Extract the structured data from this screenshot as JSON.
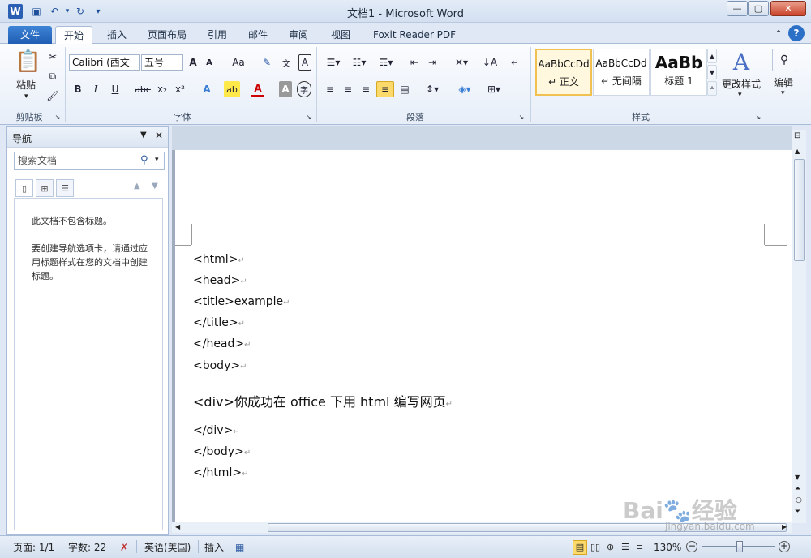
{
  "window": {
    "title": "文档1 - Microsoft Word"
  },
  "tabs": [
    "文件",
    "开始",
    "插入",
    "页面布局",
    "引用",
    "邮件",
    "审阅",
    "视图",
    "Foxit Reader PDF"
  ],
  "ribbon": {
    "clipboard": {
      "paste_label": "粘贴",
      "group_label": "剪贴板"
    },
    "font": {
      "font_name": "Calibri (西文",
      "font_size": "五号",
      "group_label": "字体"
    },
    "paragraph": {
      "group_label": "段落"
    },
    "styles": {
      "items": [
        {
          "sample": "AaBbCcDd",
          "name": "↵ 正文"
        },
        {
          "sample": "AaBbCcDd",
          "name": "↵ 无间隔"
        },
        {
          "sample": "AaBb",
          "name": "标题 1"
        }
      ],
      "change_styles_label": "更改样式",
      "group_label": "样式"
    },
    "editing": {
      "label": "编辑"
    }
  },
  "nav": {
    "title": "导航",
    "search_placeholder": "搜索文档",
    "msg1": "此文档不包含标题。",
    "msg2": "要创建导航选项卡，请通过应用标题样式在您的文档中创建标题。"
  },
  "document": {
    "lines": [
      "<html>",
      "<head>",
      "<title>example",
      "</title>",
      "</head>",
      "<body>",
      "<div>你成功在 office 下用 html 编写网页",
      "</div>",
      "</body>",
      "</html>"
    ]
  },
  "status": {
    "page": "页面: 1/1",
    "words": "字数: 22",
    "language": "英语(美国)",
    "mode": "插入",
    "zoom": "130%"
  },
  "watermark": "Baidu经验 jingyan.baidu.com"
}
